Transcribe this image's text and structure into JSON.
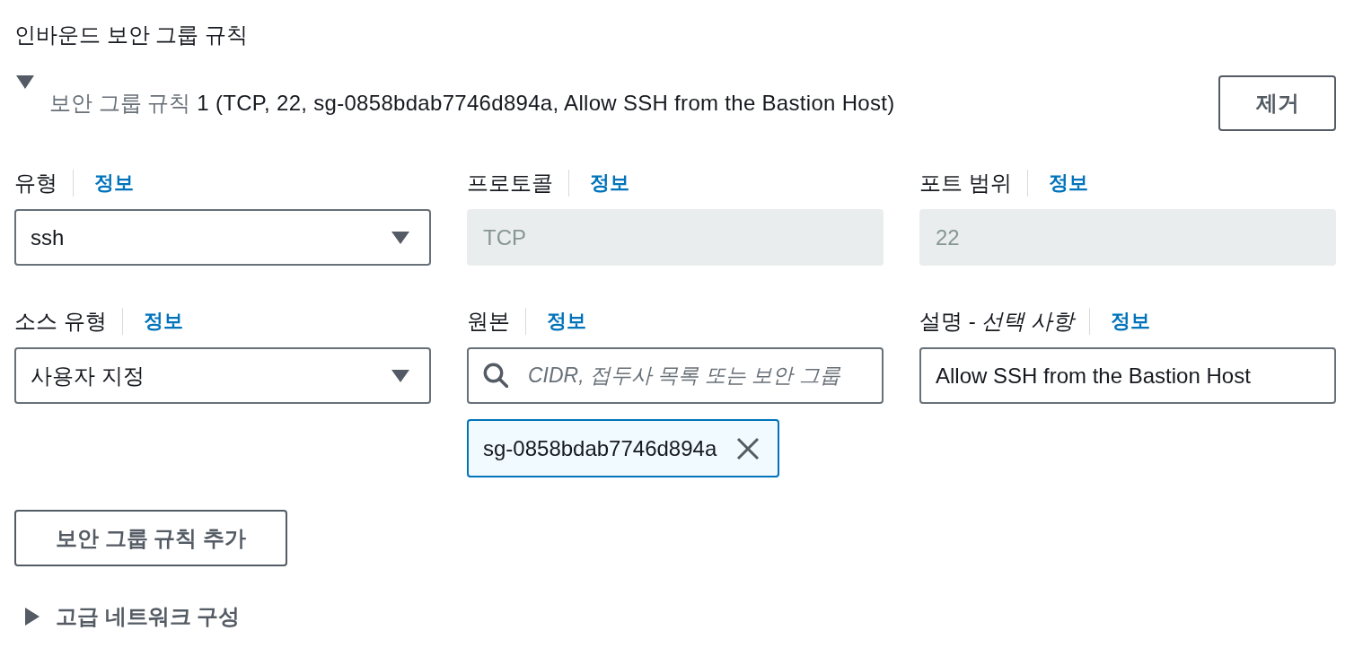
{
  "title": "인바운드 보안 그룹 규칙",
  "rules": [
    {
      "expanded": true,
      "label": "보안 그룹 규칙",
      "summary": "1 (TCP, 22, sg-0858bdab7746d894a, Allow SSH from the Bastion Host)",
      "remove_button": "제거",
      "fields": [
        {
          "kind": "select",
          "label": "유형",
          "info": "정보",
          "value": "ssh"
        },
        {
          "kind": "readonly",
          "label": "프로토콜",
          "info": "정보",
          "value": "TCP"
        },
        {
          "kind": "readonly",
          "label": "포트 범위",
          "info": "정보",
          "value": "22"
        },
        {
          "kind": "select",
          "label": "소스 유형",
          "info": "정보",
          "value": "사용자 지정"
        },
        {
          "kind": "search",
          "label": "원본",
          "info": "정보",
          "placeholder": "CIDR, 접두사 목록 또는 보안 그룹",
          "tokens": [
            "sg-0858bdab7746d894a"
          ]
        },
        {
          "kind": "text",
          "label": "설명 - *선택 사항*",
          "info": "정보",
          "value": "Allow SSH from the Bastion Host"
        }
      ]
    }
  ],
  "add_button": "보안 그룹 규칙 추가",
  "advanced": {
    "label": "고급 네트워크 구성",
    "expanded": false
  }
}
